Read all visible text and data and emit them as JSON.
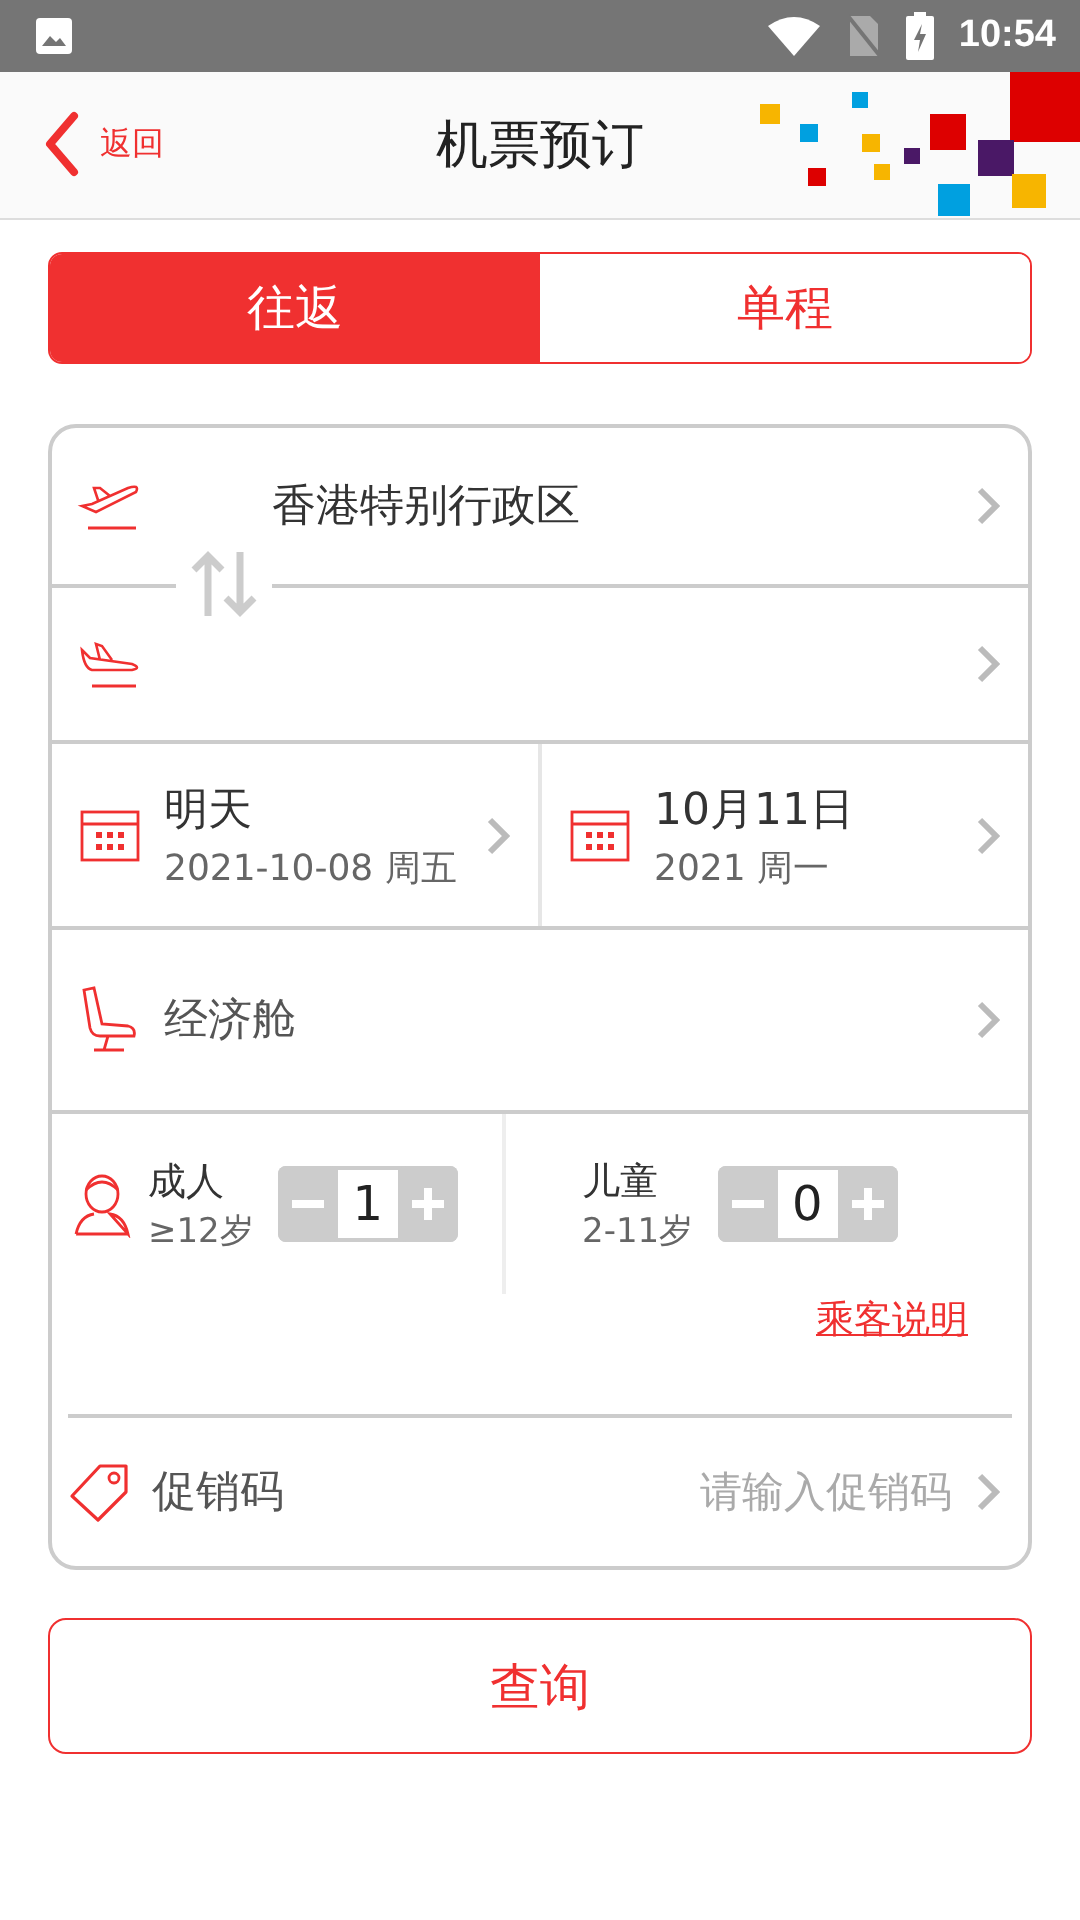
{
  "status_bar": {
    "time": "10:54"
  },
  "header": {
    "back": "返回",
    "title": "机票预订"
  },
  "trip_tabs": [
    {
      "label": "往返",
      "selected": true
    },
    {
      "label": "单程",
      "selected": false
    }
  ],
  "route": {
    "departure": "香港特别行政区"
  },
  "dates": [
    {
      "main": "明天",
      "sub": "2021-10-08 周五"
    },
    {
      "main": "10月11日",
      "sub": "2021 周一"
    }
  ],
  "cabin": "经济舱",
  "passengers": [
    {
      "label": "成人",
      "age": "≥12岁",
      "count": "1"
    },
    {
      "label": "儿童",
      "age": "2-11岁",
      "count": "0"
    }
  ],
  "passenger_note": "乘客说明",
  "promo": {
    "label": "促销码",
    "placeholder": "请输入促销码"
  },
  "search_button": "查询"
}
